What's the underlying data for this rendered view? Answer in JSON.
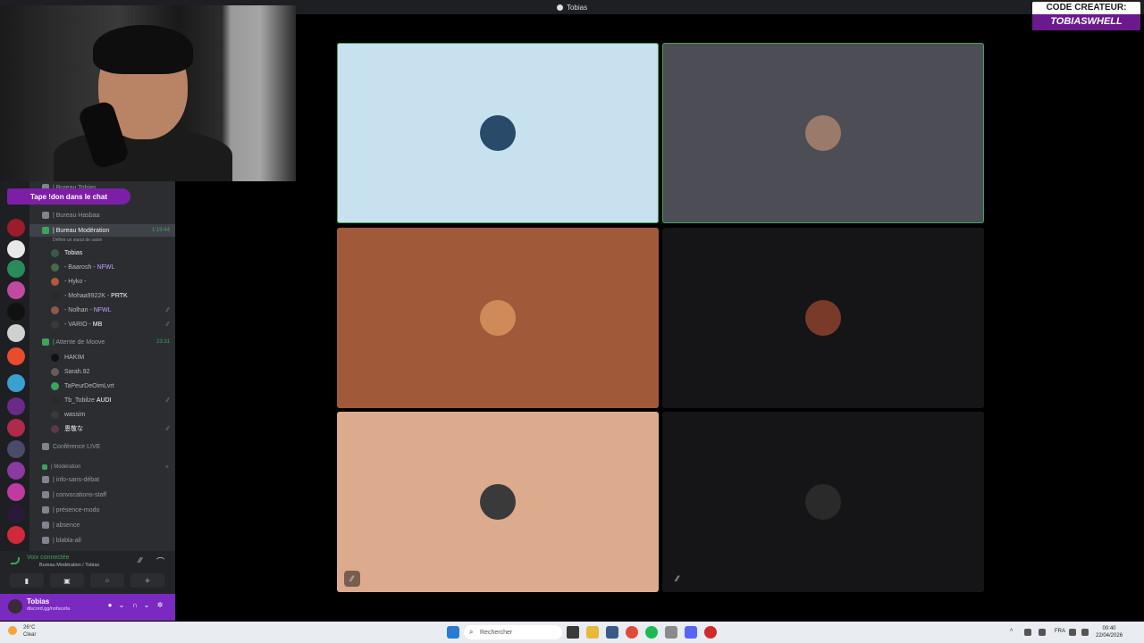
{
  "window": {
    "title": "Tobias"
  },
  "promo": {
    "text": "Tape !don dans le chat"
  },
  "creator_code": {
    "line1": "CODE CREATEUR:",
    "line2": "TOBIASWHELL"
  },
  "channels": [
    {
      "label": "| Bureau Tobias",
      "type": "voice"
    },
    {
      "label": "| Bureau Hasbaa",
      "type": "voice"
    },
    {
      "label": "| Bureau Modération",
      "type": "voice",
      "time": "1:19:44",
      "selected": true
    },
    {
      "label": "Définir un statut de salon",
      "type": "status"
    },
    {
      "label": "Tobias",
      "type": "user"
    },
    {
      "label": "- Baarosh -",
      "type": "user",
      "tag": "NFWL"
    },
    {
      "label": "- Hyko -",
      "type": "user"
    },
    {
      "label": "- Mohaa9922K -",
      "type": "user",
      "tag": "PRTK"
    },
    {
      "label": "- Nolhan -",
      "type": "user",
      "tag": "NFWL"
    },
    {
      "label": "- VARIO -",
      "type": "user",
      "tag": "MB"
    },
    {
      "label": "| Attente de Moove",
      "type": "voice",
      "time": "23:31"
    },
    {
      "label": "HAKIM",
      "type": "user"
    },
    {
      "label": "Sarah.92",
      "type": "user"
    },
    {
      "label": "TaPeurDeOimLvrt",
      "type": "user"
    },
    {
      "label": "Tb_Tobilze",
      "type": "user",
      "tag": "AUDI"
    },
    {
      "label": "wassim",
      "type": "user"
    },
    {
      "label": "恩敬な",
      "type": "user"
    },
    {
      "label": "Conférence LIVE",
      "type": "voice"
    },
    {
      "label": "| Modération",
      "type": "category"
    },
    {
      "label": "| info-sans-débat",
      "type": "text"
    },
    {
      "label": "| convocations-staff",
      "type": "text"
    },
    {
      "label": "| présence-modo",
      "type": "text"
    },
    {
      "label": "| absence",
      "type": "text"
    },
    {
      "label": "| blabla-all",
      "type": "text"
    }
  ],
  "voice_panel": {
    "status": "Voix connectée",
    "channel": "Bureau Modération / Tobias"
  },
  "user_panel": {
    "name": "Tobias",
    "status": "discord.gg/nofacefa"
  },
  "tiles": [
    {
      "bg": "#c7e2ee",
      "avatar": "#2a4a6a",
      "speaking": true,
      "muted": false
    },
    {
      "bg": "#4c4d55",
      "avatar": "#9a7a6a",
      "speaking": true,
      "muted": false
    },
    {
      "bg": "#a05a3a",
      "avatar": "#d08a5a",
      "speaking": false,
      "muted": false
    },
    {
      "bg": "#151517",
      "avatar": "#7a3a2a",
      "speaking": false,
      "muted": false
    },
    {
      "bg": "#dcab8e",
      "avatar": "#3a3a3a",
      "speaking": false,
      "muted": true
    },
    {
      "bg": "#151517",
      "avatar": "#2a2a2a",
      "speaking": false,
      "muted": true
    }
  ],
  "weather": {
    "temp": "26°C",
    "condition": "Clear"
  },
  "taskbar": {
    "search_placeholder": "Rechercher",
    "lang": "FRA",
    "time": "00:40",
    "date": "22/04/2026"
  }
}
